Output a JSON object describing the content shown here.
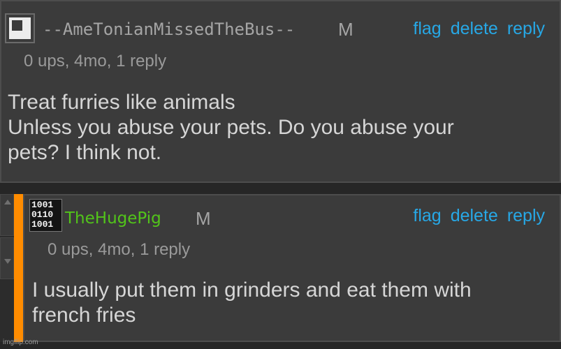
{
  "comment1": {
    "username": "--AmeTonianMissedTheBus--",
    "badge": "M",
    "actions": {
      "flag": "flag",
      "delete": "delete",
      "reply": "reply"
    },
    "meta": "0 ups, 4mo, 1 reply",
    "body_lines": [
      "Treat furries like animals",
      "Unless you abuse your pets. Do you abuse your",
      "pets? I think not."
    ]
  },
  "comment2": {
    "avatar_rows": [
      "1001",
      "0110",
      "1001"
    ],
    "username": "TheHugePig",
    "badge": "M",
    "actions": {
      "flag": "flag",
      "delete": "delete",
      "reply": "reply"
    },
    "meta": "0 ups, 4mo, 1 reply",
    "body_lines": [
      "I usually put them in grinders and eat them with",
      "french fries"
    ]
  },
  "watermark": "imgflip.com",
  "colors": {
    "background": "#262626",
    "panel": "#3b3b3b",
    "link": "#27a8e6",
    "username_green": "#52c41a",
    "reply_bar": "#ff8c00",
    "text": "#d6d6d6",
    "meta": "#9a9a9a"
  },
  "icons": {
    "comment1_avatar": "square-logo-icon",
    "comment2_avatar": "binary-avatar-icon",
    "gutter_up": "chevron-up-icon",
    "gutter_down": "chevron-down-icon"
  }
}
